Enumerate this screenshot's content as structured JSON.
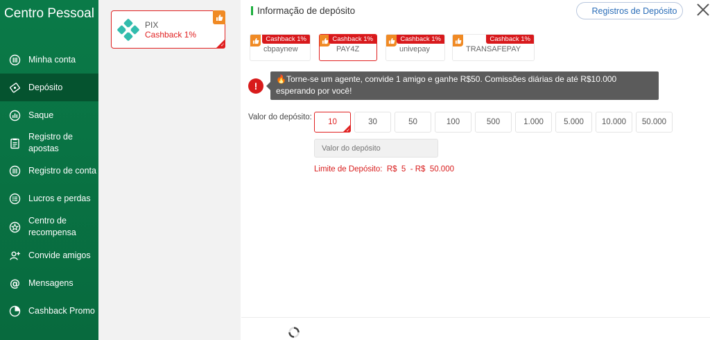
{
  "sidebar": {
    "title": "Centro Pessoal",
    "items": [
      {
        "label": "Minha conta",
        "icon": "account-icon"
      },
      {
        "label": "Depósito",
        "icon": "deposit-icon",
        "active": true
      },
      {
        "label": "Saque",
        "icon": "withdraw-icon"
      },
      {
        "label": "Registro de apostas",
        "icon": "bet-records-icon"
      },
      {
        "label": "Registro de conta",
        "icon": "account-records-icon"
      },
      {
        "label": "Lucros e perdas",
        "icon": "profit-loss-icon"
      },
      {
        "label": "Centro de recompensa",
        "icon": "reward-icon"
      },
      {
        "label": "Convide amigos",
        "icon": "invite-icon"
      },
      {
        "label": "Mensagens",
        "icon": "at-icon"
      },
      {
        "label": "Cashback Promo",
        "icon": "cashback-icon"
      }
    ]
  },
  "method": {
    "name": "PIX",
    "cashback": "Cashback 1%"
  },
  "header": {
    "title": "Informação de depósito",
    "records_button": "Registros de Depósito"
  },
  "channels": [
    {
      "name": "cbpaynew",
      "tag": "Cashback 1%"
    },
    {
      "name": "PAY4Z",
      "tag": "Cashback 1%",
      "active": true
    },
    {
      "name": "univepay",
      "tag": "Cashback 1%"
    },
    {
      "name": "TRANSAFEPAY",
      "tag": "Cashback 1%"
    }
  ],
  "notice": "🔥Torne-se um agente, convide 1 amigo e ganhe R$50. Comissões diárias de até R$10.000 esperando por você!",
  "deposit": {
    "label": "Valor do depósito:",
    "amounts": [
      "10",
      "30",
      "50",
      "100",
      "500",
      "1.000",
      "5.000",
      "10.000",
      "50.000"
    ],
    "selected": "10",
    "placeholder": "Valor do depósito",
    "limit": "Limite de Depósito:  R$  5  - R$  50.000"
  },
  "colors": {
    "sidebar_green": "#0a7a48",
    "accent_red": "#e02020",
    "records_blue": "#2a6db8",
    "header_bar": "#1aae3c"
  }
}
